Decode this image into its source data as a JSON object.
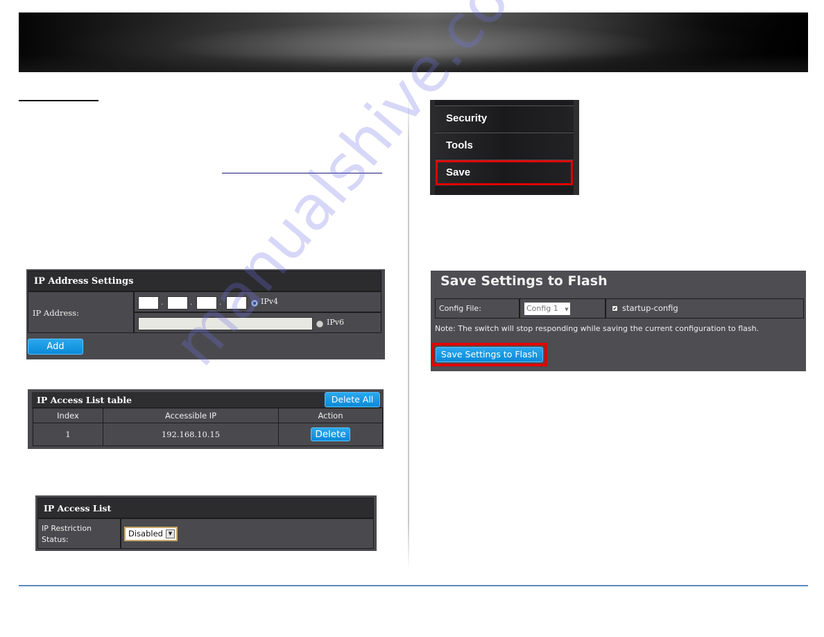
{
  "banner": {
    "icon": "header-banner"
  },
  "ip_address_settings": {
    "title": "IP Address Settings",
    "ip_label": "IP Address:",
    "ipv4": {
      "octets": [
        "",
        "",
        "",
        ""
      ],
      "separator": ".",
      "label": "IPv4",
      "selected": true
    },
    "ipv6": {
      "value": "",
      "label": "IPv6",
      "selected": false
    },
    "add_label": "Add"
  },
  "ip_access_list_table": {
    "title": "IP Access List table",
    "delete_all_label": "Delete All",
    "columns": [
      "Index",
      "Accessible IP",
      "Action"
    ],
    "rows": [
      {
        "index": "1",
        "ip": "192.168.10.15",
        "action": "Delete"
      }
    ]
  },
  "ip_access_list": {
    "title": "IP Access List",
    "restriction_label_line1": "IP Restriction",
    "restriction_label_line2": "Status:",
    "restriction_value": "Disabled"
  },
  "menu": {
    "items": [
      {
        "label": "Security"
      },
      {
        "label": "Tools"
      },
      {
        "label": "Save",
        "highlighted": true
      }
    ]
  },
  "save_settings": {
    "title": "Save Settings to Flash",
    "config_file_label": "Config File:",
    "config_file_value": "Config 1",
    "startup_config_label": "startup-config",
    "startup_config_checked": true,
    "note": "Note: The switch will stop responding while saving the current configuration to flash.",
    "button_label": "Save Settings to Flash"
  },
  "watermark": "manualshive.com",
  "colors": {
    "accent_blue": "#0b8ad8",
    "highlight_red": "#e00000",
    "panel_bg": "#4a4a4e",
    "footer_line": "#5b87bf"
  }
}
